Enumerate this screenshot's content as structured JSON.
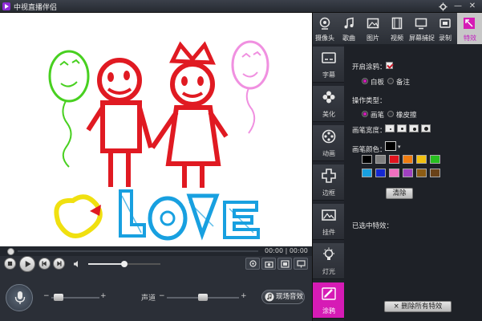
{
  "window": {
    "title": "中视直播伴侣",
    "settings_icon": "gear-icon",
    "minimize_glyph": "—",
    "close_glyph": "✕"
  },
  "player": {
    "time": "00:00 | 00:00",
    "volume": 0.5
  },
  "bottom": {
    "mic_slider": 0.05,
    "channel_label": "声道",
    "channel_slider": 0.5,
    "minus": "−",
    "plus": "+",
    "sound_effect_button": "现场音效"
  },
  "top_tabs": [
    {
      "label": "摄像头",
      "icon": "webcam-icon"
    },
    {
      "label": "歌曲",
      "icon": "music-note-icon"
    },
    {
      "label": "图片",
      "icon": "image-icon"
    },
    {
      "label": "视频",
      "icon": "film-icon"
    },
    {
      "label": "屏幕捕捉",
      "icon": "screen-capture-icon"
    },
    {
      "label": "录制",
      "icon": "record-icon"
    },
    {
      "label": "特效",
      "icon": "effects-icon"
    }
  ],
  "side_nav": [
    {
      "label": "字幕",
      "icon": "subtitle-icon"
    },
    {
      "label": "美化",
      "icon": "flower-icon"
    },
    {
      "label": "动画",
      "icon": "film-reel-icon"
    },
    {
      "label": "边框",
      "icon": "cross-frame-icon"
    },
    {
      "label": "挂件",
      "icon": "picture-icon"
    },
    {
      "label": "灯光",
      "icon": "light-icon"
    },
    {
      "label": "涂鸦",
      "icon": "brush-icon"
    }
  ],
  "panel": {
    "enable_graffiti": "开启涂鸦：",
    "mode_whiteboard": "白板",
    "mode_note": "备注",
    "op_type": "操作类型：",
    "op_pen": "画笔",
    "op_eraser": "橡皮擦",
    "pen_width": "画笔宽度：",
    "pen_color": "画笔颜色：",
    "clear_button": "清除",
    "selected_effects": "已选中特效：",
    "delete_all_button": "× 删除所有特效",
    "current_color": "#000000",
    "palette": [
      "#000000",
      "#808080",
      "#e0141e",
      "#f07c10",
      "#f0c010",
      "#28c020",
      "#18a0e0",
      "#1428d0",
      "#f070c0",
      "#a040c0",
      "#8c5c14",
      "#6a4218"
    ]
  }
}
